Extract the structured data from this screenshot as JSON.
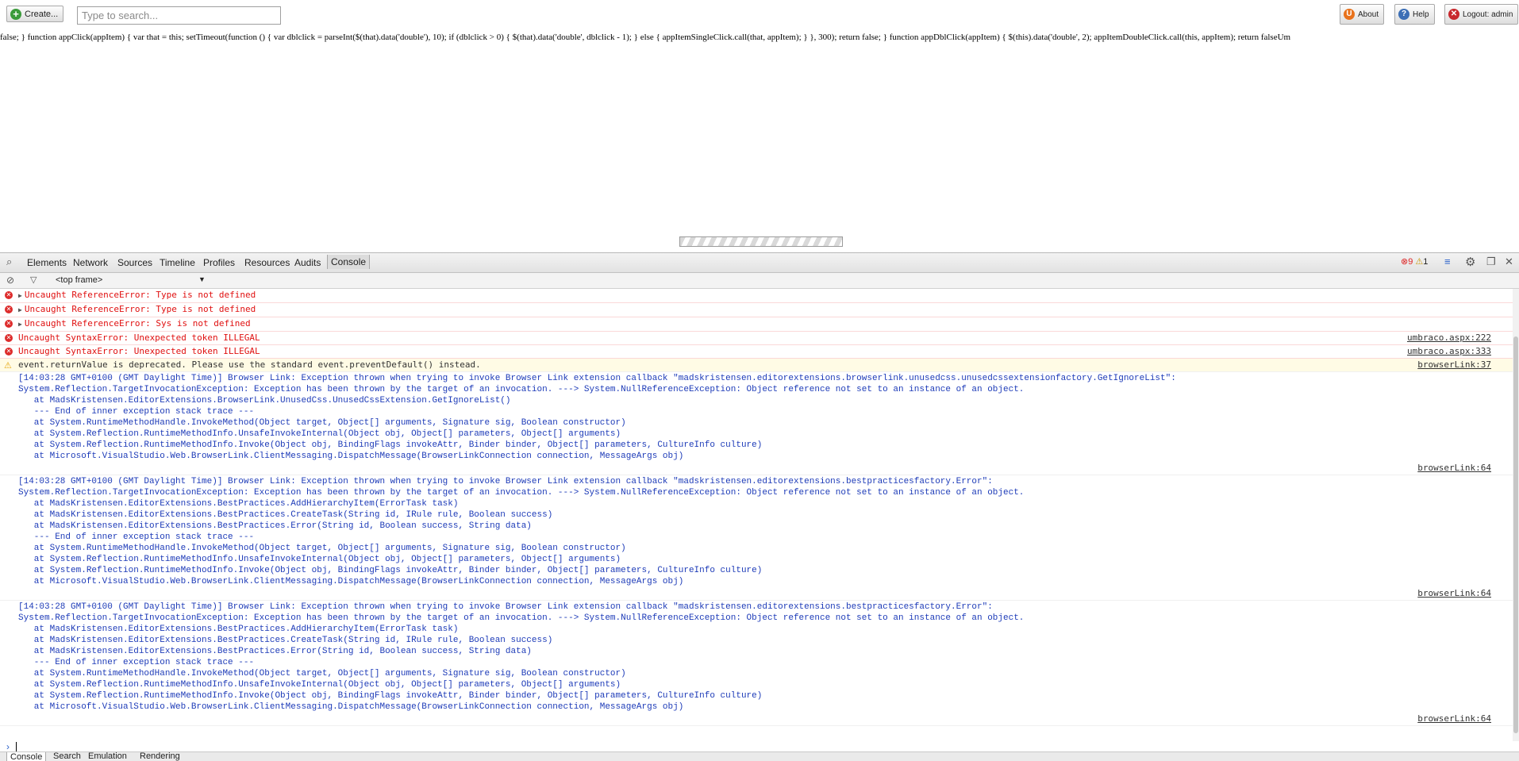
{
  "topbar": {
    "create_label": "Create...",
    "search_placeholder": "Type to search...",
    "about_label": "About",
    "help_label": "Help",
    "logout_label": "Logout: admin"
  },
  "leaked_script": "false; } function appClick(appItem) { var that = this; setTimeout(function () { var dblclick = parseInt($(that).data('double'), 10); if (dblclick > 0) { $(that).data('double', dblclick - 1); } else { appItemSingleClick.call(that, appItem); } }, 300); return false; } function appDblClick(appItem) { $(this).data('double', 2); appItemDoubleClick.call(this, appItem); return falseUm",
  "devtools": {
    "tabs": [
      "Elements",
      "Network",
      "Sources",
      "Timeline",
      "Profiles",
      "Resources",
      "Audits",
      "Console"
    ],
    "active_tab": "Console",
    "error_count": "9",
    "warning_count": "1",
    "frame_selector": "<top frame>",
    "bottom_tabs": [
      "Console",
      "Search",
      "Emulation",
      "Rendering"
    ],
    "messages": [
      {
        "text": "Uncaught ReferenceError: Type is not defined"
      },
      {
        "text": "Uncaught ReferenceError: Type is not defined"
      },
      {
        "text": "Uncaught ReferenceError: Sys is not defined"
      },
      {
        "text": "Uncaught SyntaxError: Unexpected token ILLEGAL",
        "source": "umbraco.aspx:222"
      },
      {
        "text": "Uncaught SyntaxError: Unexpected token ILLEGAL",
        "source": "umbraco.aspx:333"
      },
      {
        "text": "event.returnValue is deprecated. Please use the standard event.preventDefault() instead.",
        "source": "browserLink:37"
      }
    ],
    "blocks": [
      {
        "lines": "[14:03:28 GMT+0100 (GMT Daylight Time)] Browser Link: Exception thrown when trying to invoke Browser Link extension callback \"madskristensen.editorextensions.browserlink.unusedcss.unusedcssextensionfactory.GetIgnoreList\":\nSystem.Reflection.TargetInvocationException: Exception has been thrown by the target of an invocation. ---> System.NullReferenceException: Object reference not set to an instance of an object.\n   at MadsKristensen.EditorExtensions.BrowserLink.UnusedCss.UnusedCssExtension.GetIgnoreList()\n   --- End of inner exception stack trace ---\n   at System.RuntimeMethodHandle.InvokeMethod(Object target, Object[] arguments, Signature sig, Boolean constructor)\n   at System.Reflection.RuntimeMethodInfo.UnsafeInvokeInternal(Object obj, Object[] parameters, Object[] arguments)\n   at System.Reflection.RuntimeMethodInfo.Invoke(Object obj, BindingFlags invokeAttr, Binder binder, Object[] parameters, CultureInfo culture)\n   at Microsoft.VisualStudio.Web.BrowserLink.ClientMessaging.DispatchMessage(BrowserLinkConnection connection, MessageArgs obj)",
        "source": "browserLink:64"
      },
      {
        "lines": "[14:03:28 GMT+0100 (GMT Daylight Time)] Browser Link: Exception thrown when trying to invoke Browser Link extension callback \"madskristensen.editorextensions.bestpracticesfactory.Error\":\nSystem.Reflection.TargetInvocationException: Exception has been thrown by the target of an invocation. ---> System.NullReferenceException: Object reference not set to an instance of an object.\n   at MadsKristensen.EditorExtensions.BestPractices.AddHierarchyItem(ErrorTask task)\n   at MadsKristensen.EditorExtensions.BestPractices.CreateTask(String id, IRule rule, Boolean success)\n   at MadsKristensen.EditorExtensions.BestPractices.Error(String id, Boolean success, String data)\n   --- End of inner exception stack trace ---\n   at System.RuntimeMethodHandle.InvokeMethod(Object target, Object[] arguments, Signature sig, Boolean constructor)\n   at System.Reflection.RuntimeMethodInfo.UnsafeInvokeInternal(Object obj, Object[] parameters, Object[] arguments)\n   at System.Reflection.RuntimeMethodInfo.Invoke(Object obj, BindingFlags invokeAttr, Binder binder, Object[] parameters, CultureInfo culture)\n   at Microsoft.VisualStudio.Web.BrowserLink.ClientMessaging.DispatchMessage(BrowserLinkConnection connection, MessageArgs obj)",
        "source": "browserLink:64"
      },
      {
        "lines": "[14:03:28 GMT+0100 (GMT Daylight Time)] Browser Link: Exception thrown when trying to invoke Browser Link extension callback \"madskristensen.editorextensions.bestpracticesfactory.Error\":\nSystem.Reflection.TargetInvocationException: Exception has been thrown by the target of an invocation. ---> System.NullReferenceException: Object reference not set to an instance of an object.\n   at MadsKristensen.EditorExtensions.BestPractices.AddHierarchyItem(ErrorTask task)\n   at MadsKristensen.EditorExtensions.BestPractices.CreateTask(String id, IRule rule, Boolean success)\n   at MadsKristensen.EditorExtensions.BestPractices.Error(String id, Boolean success, String data)\n   --- End of inner exception stack trace ---\n   at System.RuntimeMethodHandle.InvokeMethod(Object target, Object[] arguments, Signature sig, Boolean constructor)\n   at System.Reflection.RuntimeMethodInfo.UnsafeInvokeInternal(Object obj, Object[] parameters, Object[] arguments)\n   at System.Reflection.RuntimeMethodInfo.Invoke(Object obj, BindingFlags invokeAttr, Binder binder, Object[] parameters, CultureInfo culture)\n   at Microsoft.VisualStudio.Web.BrowserLink.ClientMessaging.DispatchMessage(BrowserLinkConnection connection, MessageArgs obj)",
        "source": "browserLink:64"
      }
    ]
  }
}
